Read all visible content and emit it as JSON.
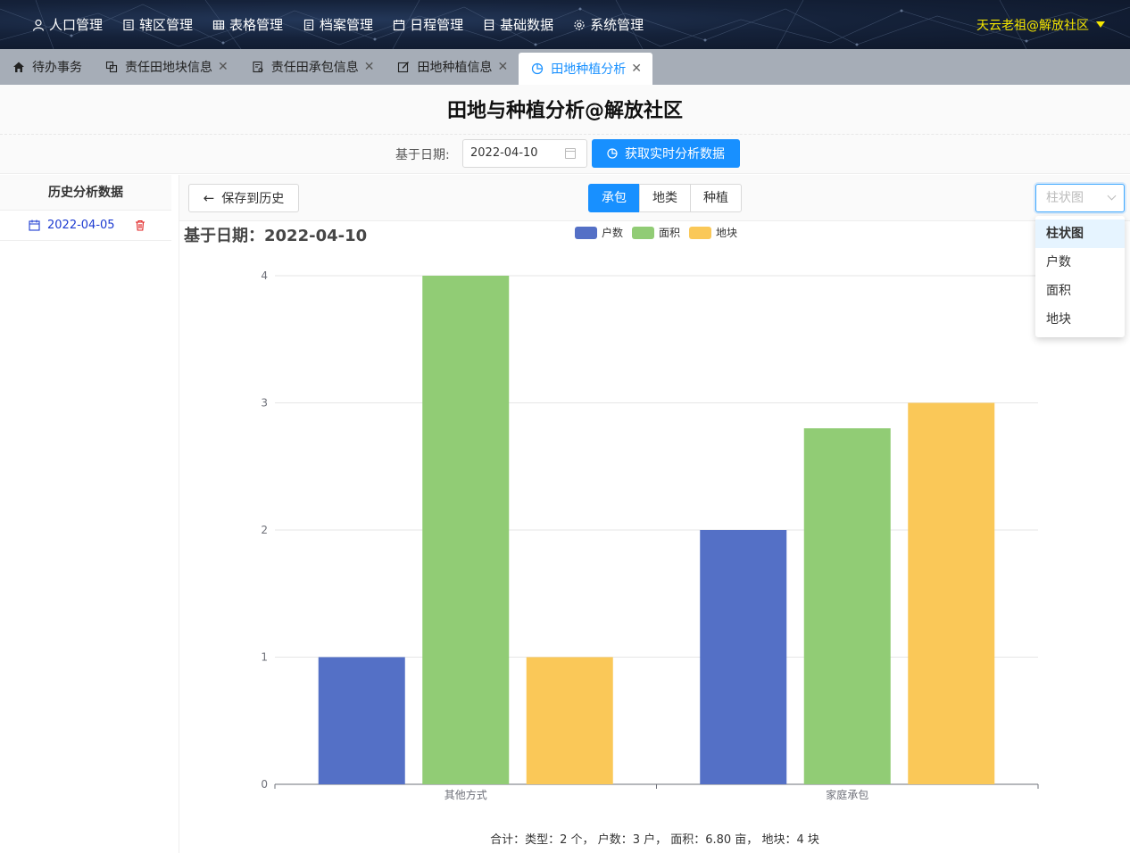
{
  "nav": {
    "items": [
      {
        "label": "人口管理",
        "icon": "user-icon"
      },
      {
        "label": "辖区管理",
        "icon": "building-icon"
      },
      {
        "label": "表格管理",
        "icon": "table-icon"
      },
      {
        "label": "档案管理",
        "icon": "file-icon"
      },
      {
        "label": "日程管理",
        "icon": "calendar-icon"
      },
      {
        "label": "基础数据",
        "icon": "database-icon"
      },
      {
        "label": "系统管理",
        "icon": "gear-icon"
      }
    ],
    "user": "天云老祖@解放社区"
  },
  "tabs": [
    {
      "label": "待办事务",
      "icon": "home-icon",
      "closable": false
    },
    {
      "label": "责任田地块信息",
      "icon": "copy-icon",
      "closable": true
    },
    {
      "label": "责任田承包信息",
      "icon": "document-icon",
      "closable": true
    },
    {
      "label": "田地种植信息",
      "icon": "edit-icon",
      "closable": true
    },
    {
      "label": "田地种植分析",
      "icon": "pie-icon",
      "closable": true,
      "active": true
    }
  ],
  "page": {
    "title": "田地与种植分析@解放社区",
    "date_label": "基于日期:",
    "date_value": "2022-04-10",
    "fetch_label": "获取实时分析数据"
  },
  "sidebar": {
    "header": "历史分析数据",
    "items": [
      {
        "date": "2022-04-05"
      }
    ]
  },
  "toolbar": {
    "save_label": "保存到历史",
    "segments": [
      "承包",
      "地类",
      "种植"
    ],
    "active_segment": "承包",
    "select_placeholder": "柱状图",
    "options": [
      "柱状图",
      "户数",
      "面积",
      "地块"
    ],
    "selected_option": "柱状图"
  },
  "chart_data": {
    "type": "bar",
    "title": "基于日期：2022-04-10",
    "categories": [
      "其他方式",
      "家庭承包"
    ],
    "series": [
      {
        "name": "户数",
        "values": [
          1,
          2
        ],
        "color": "#5470c6"
      },
      {
        "name": "面积",
        "values": [
          4,
          2.8
        ],
        "color": "#91cc75"
      },
      {
        "name": "地块",
        "values": [
          1,
          3
        ],
        "color": "#fac858"
      }
    ],
    "ylim": [
      0,
      4
    ],
    "yticks": [
      0,
      1,
      2,
      3,
      4
    ],
    "grid": true,
    "legend": "top-center"
  },
  "summary": {
    "text": "合计：类型：2 个， 户数：3 户， 面积：6.80 亩， 地块：4 块"
  },
  "colors": {
    "primary": "#1890ff",
    "user_name": "#f5e600",
    "date_link": "#1d3bd1",
    "delete": "#e02020"
  }
}
